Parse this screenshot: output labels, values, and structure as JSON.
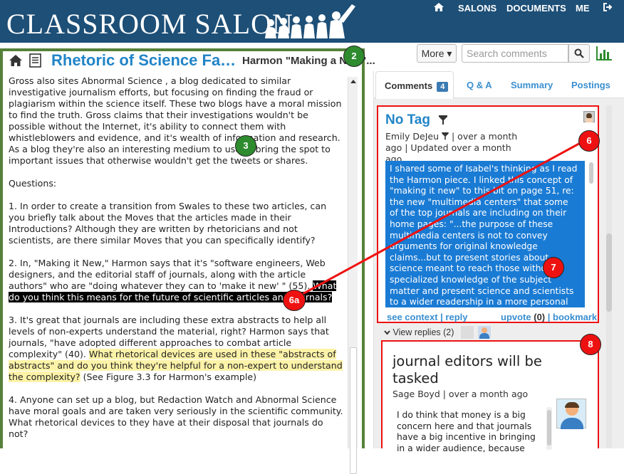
{
  "app": {
    "brand": "CLASSROOM SALON"
  },
  "nav": {
    "home_icon": "home-icon",
    "salons": "SALONS",
    "documents": "DOCUMENTS",
    "me": "ME",
    "logout_icon": "logout-icon"
  },
  "doc": {
    "title": "Rhetoric of Science Fa…",
    "subtitle": "Harmon \"Making a New\"...",
    "paragraphs": {
      "p1": "Gross also sites Abnormal Science , a blog dedicated to similar investigative journalism efforts, but focusing on finding the fraud or plagiarism within the science itself. These two blogs have a moral mission to find the truth. Gross claims that their investigations wouldn't be possible without the Internet, it's ability to connect them with whistleblowers and evidence, and it's wealth of information and research. As a blog they're also an interesting medium to use to bring the spot to important issues that otherwise wouldn't get the tweets or shares.",
      "questions": "Questions:",
      "q1": "1. In order to create a transition from Swales to these two articles, can you briefly talk about the Moves that the articles made in their Introductions? Although they are written by rhetoricians and not scientists, are there similar Moves that you can specifically identify?",
      "q2_pre": "2. In, \"Making it New,\" Harmon says that it's \"software engineers, Web designers, and the editorial staff of journals, along with the article authors\" who are \"doing whatever they can to 'make it new' \" (55). ",
      "q2_hl": "What do you think this means for the future of scientific articles and journals?",
      "q3_pre": "3. It's great that journals are including these extra abstracts to help all levels of non-experts understand the material, right? Harmon says that journals, \"have adopted different approaches to combat article complexity\" (40). ",
      "q3_hl": "What rhetorical devices are used in these \"abstracts of abstracts\" and do you think they're helpful for a non-expert to understand the complexity?",
      "q3_post": " (See Figure 3.3 for Harmon's example)",
      "q4": "4. Anyone can set up a blog, but Redaction Watch and Abnormal Science have moral goals and are taken very seriously in the scientific community. What rhetorical devices to they have at their disposal that journals do not?"
    }
  },
  "toolbar": {
    "more_label": "More ▾",
    "search_placeholder": "Search comments"
  },
  "tabs": {
    "comments": "Comments",
    "comments_count": "4",
    "qa": "Q & A",
    "summary": "Summary",
    "postings": "Postings"
  },
  "comment1": {
    "tag": "No Tag",
    "author": "Emily DeJeu",
    "time1": "|   over a month",
    "time2": "ago | Updated over a month ago",
    "text": "I shared some of Isabel's thinking as I read the Harmon piece. I linked this concept of \"making it new\" to this bit on page 51, re: the new \"multimedia centers\" that some of the top journals are including on their home pages: \"...the purpose of these multimedia centers is not to convey arguments for original knowledge claims...but to present stories about science meant to reach those without specialized knowledge of the subject matter and present science and scientists to a wider readership in a more personal light.\"\n\nThis made me wonder if the added",
    "see_context": "see context",
    "reply": "reply",
    "upvote": "upvote",
    "upvote_count": "(0)",
    "bookmark": "bookmark",
    "view_replies": "View replies",
    "replies_count": "(2)"
  },
  "comment2": {
    "title": "journal editors will be tasked",
    "author": "Sage Boyd",
    "time": "|  over a month ago",
    "text": "I do think that money is a big concern here and that journals have a big incentive in bringing in a wider audience, because"
  },
  "markers": {
    "m2": "2",
    "m3": "3",
    "m6": "6",
    "m6a": "6a",
    "m7": "7",
    "m8": "8"
  },
  "colors": {
    "header_bg": "#1d4f77",
    "accent": "#2184c7",
    "highlight_blue": "#1a7bd4",
    "annotation_red": "#ee1111",
    "annotation_green": "#2e8b2e",
    "frame_green": "#57813a"
  }
}
